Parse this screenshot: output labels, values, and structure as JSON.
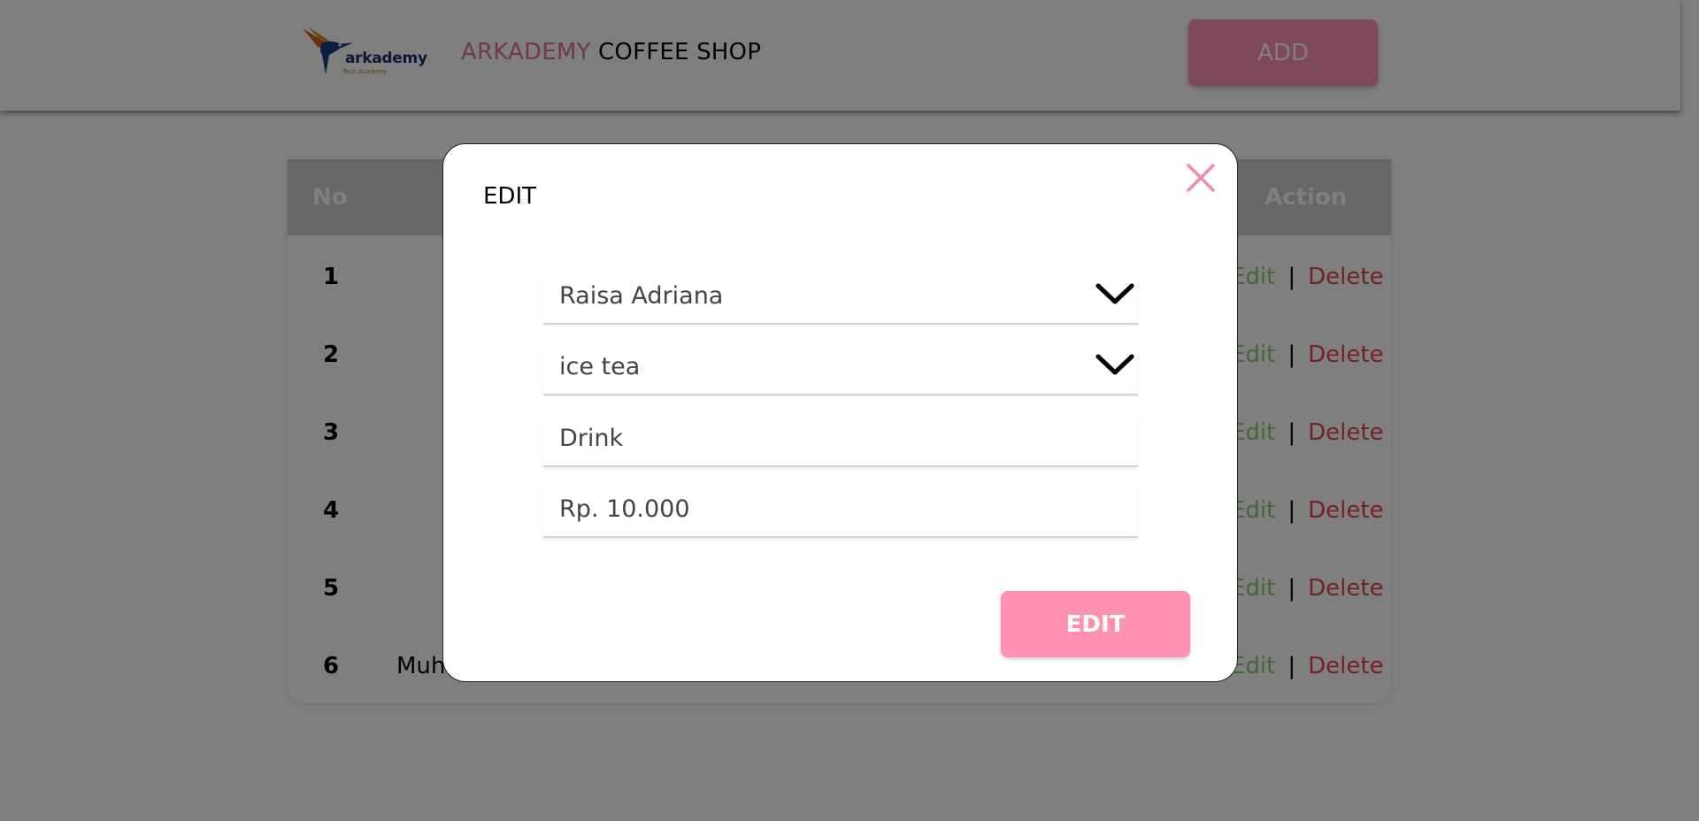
{
  "header": {
    "logo_text": "arkademy",
    "logo_sub": "Tech Academy",
    "brand_accent": "ARKADEMY",
    "brand_rest": " COFFEE SHOP",
    "add_label": "ADD"
  },
  "table": {
    "headers": {
      "no": "No",
      "action": "Action"
    },
    "rows": [
      {
        "no": "1",
        "name": "",
        "edit": "Edit",
        "sep": "|",
        "delete": "Delete"
      },
      {
        "no": "2",
        "name": "",
        "edit": "Edit",
        "sep": "|",
        "delete": "Delete"
      },
      {
        "no": "3",
        "name": "",
        "edit": "Edit",
        "sep": "|",
        "delete": "Delete"
      },
      {
        "no": "4",
        "name": "",
        "edit": "Edit",
        "sep": "|",
        "delete": "Delete"
      },
      {
        "no": "5",
        "name": "",
        "edit": "Edit",
        "sep": "|",
        "delete": "Delete"
      },
      {
        "no": "6",
        "name": "Muh",
        "edit": "Edit",
        "sep": "|",
        "delete": "Delete"
      }
    ]
  },
  "modal": {
    "title": "EDIT",
    "cashier_value": "Raisa Adriana",
    "product_value": "ice tea",
    "category_value": "Drink",
    "price_value": "Rp. 10.000",
    "submit_label": "EDIT"
  },
  "colors": {
    "accent_pink": "#ff92b3",
    "brand_pink": "#e27494",
    "edit_green": "#8ccc6b",
    "delete_red": "#e0454d"
  },
  "icons": [
    "hummingbird-logo-icon",
    "close-icon",
    "chevron-down-icon"
  ]
}
